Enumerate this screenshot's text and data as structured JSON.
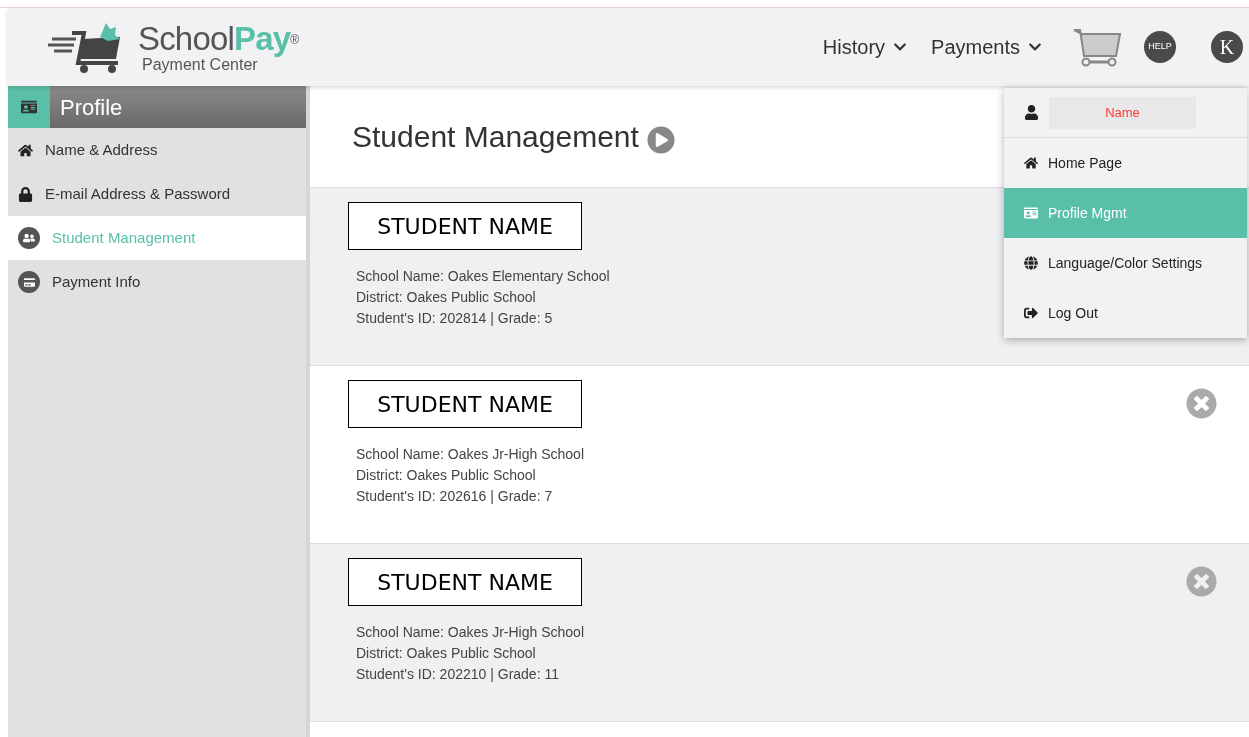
{
  "header": {
    "logo": {
      "name_plain": "School",
      "name_accent": "Pay",
      "registered": "®",
      "subtitle": "Payment Center"
    },
    "nav": [
      {
        "label": "History"
      },
      {
        "label": "Payments"
      }
    ],
    "help": "HELP",
    "avatar": "K"
  },
  "sidebar": {
    "title": "Profile",
    "items": [
      {
        "label": "Name & Address",
        "kind": "home",
        "selected": false
      },
      {
        "label": "E-mail Address & Password",
        "kind": "lock",
        "selected": false
      },
      {
        "label": "Student Management",
        "kind": "students",
        "selected": true
      },
      {
        "label": "Payment Info",
        "kind": "card",
        "selected": false
      }
    ]
  },
  "page_title": "Student Management",
  "students": [
    {
      "name": "STUDENT NAME",
      "school": "School Name: Oakes Elementary School",
      "district": "District: Oakes Public School",
      "id_grade": "Student's ID: 202814 | Grade: 5"
    },
    {
      "name": "STUDENT NAME",
      "school": "School Name: Oakes Jr-High School",
      "district": "District: Oakes Public School",
      "id_grade": "Student's ID: 202616 | Grade: 7",
      "removable": true
    },
    {
      "name": "STUDENT NAME",
      "school": "School Name: Oakes Jr-High School",
      "district": "District: Oakes Public School",
      "id_grade": "Student's ID: 202210 | Grade: 11",
      "removable": true
    }
  ],
  "user_menu": {
    "user_name": "Name",
    "items": [
      {
        "label": "Home Page",
        "kind": "home",
        "selected": false
      },
      {
        "label": "Profile Mgmt",
        "kind": "card",
        "selected": true
      },
      {
        "label": "Language/Color Settings",
        "kind": "globe",
        "selected": false
      },
      {
        "label": "Log Out",
        "kind": "logout",
        "selected": false
      }
    ]
  }
}
